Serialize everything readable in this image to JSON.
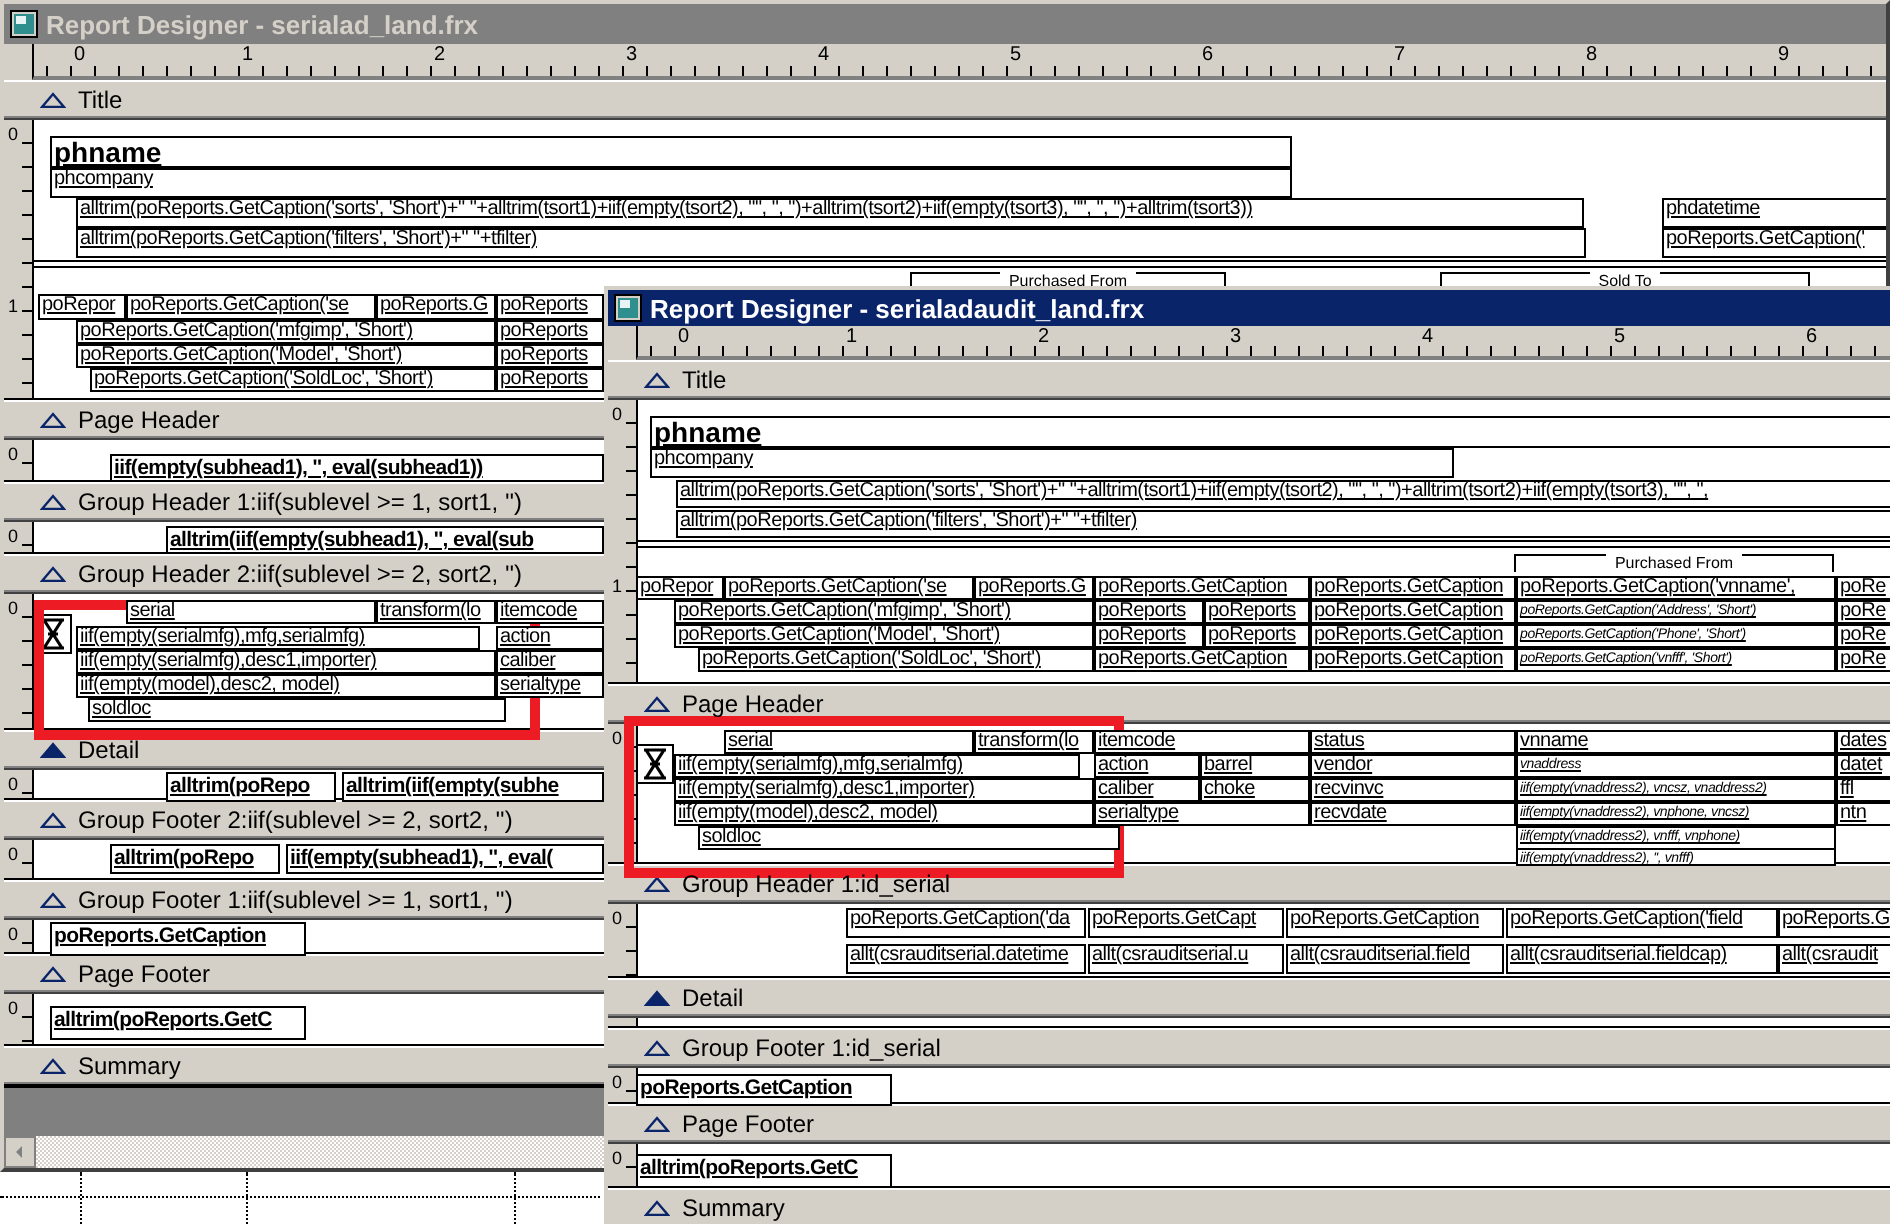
{
  "windows": [
    {
      "title": "Report Designer - serialad_land.frx",
      "active": false,
      "ruler": [
        "0",
        "1",
        "2",
        "3",
        "4",
        "5",
        "6",
        "7",
        "8",
        "9"
      ],
      "bands": [
        {
          "label": "Title",
          "selected": false,
          "ruler_labels": [
            "0",
            "1"
          ],
          "captions": [
            "Purchased From",
            "Sold To"
          ],
          "fields": [
            {
              "text": "phname",
              "kind": "title"
            },
            {
              "text": "phcompany",
              "kind": "plain"
            },
            {
              "text": "alltrim(poReports.GetCaption('sorts', 'Short')+\"  \"+alltrim(tsort1)+iif(empty(tsort2), \"\", \", \")+alltrim(tsort2)+iif(empty(tsort3), \"\", \", \")+alltrim(tsort3))",
              "kind": "plain"
            },
            {
              "text": "alltrim(poReports.GetCaption('filters', 'Short')+\"  \"+tfilter)",
              "kind": "plain"
            },
            {
              "text": "phdatetime",
              "kind": "plain"
            },
            {
              "text": "poReports.GetCaption('",
              "kind": "plain"
            },
            {
              "text": "poRepor",
              "kind": "plain"
            },
            {
              "text": "poReports.GetCaption('se",
              "kind": "plain"
            },
            {
              "text": "poReports.G",
              "kind": "plain"
            },
            {
              "text": "poReports",
              "kind": "plain"
            },
            {
              "text": "poReports.GetCaption('mfgimp', 'Short')",
              "kind": "plain"
            },
            {
              "text": "poReports",
              "kind": "plain"
            },
            {
              "text": "poReports.GetCaption('Model', 'Short')",
              "kind": "plain"
            },
            {
              "text": "poReports",
              "kind": "plain"
            },
            {
              "text": "poReports.GetCaption('SoldLoc', 'Short')",
              "kind": "plain"
            },
            {
              "text": "poReports",
              "kind": "plain"
            }
          ]
        },
        {
          "label": "Page Header",
          "selected": false,
          "ruler_labels": [
            "0"
          ],
          "fields": [
            {
              "text": "iif(empty(subhead1), '', eval(subhead1))",
              "kind": "bold"
            }
          ]
        },
        {
          "label": "Group Header 1:iif(sublevel >= 1, sort1, '')",
          "selected": false,
          "ruler_labels": [
            "0"
          ],
          "fields": [
            {
              "text": "alltrim(iif(empty(subhead1), '', eval(sub",
              "kind": "bold"
            }
          ]
        },
        {
          "label": "Group Header 2:iif(sublevel >= 2, sort2, '')",
          "selected": false,
          "ruler_labels": [
            "0"
          ],
          "fields": [
            {
              "text": "serial",
              "kind": "plain"
            },
            {
              "text": "transform(lo",
              "kind": "plain"
            },
            {
              "text": "itemcode",
              "kind": "plain"
            },
            {
              "text": "iif(empty(serialmfg),mfg,serialmfg)",
              "kind": "plain"
            },
            {
              "text": "action",
              "kind": "plain"
            },
            {
              "text": "iif(empty(serialmfg),desc1,importer)",
              "kind": "plain"
            },
            {
              "text": "caliber",
              "kind": "plain"
            },
            {
              "text": "iif(empty(model),desc2, model)",
              "kind": "plain"
            },
            {
              "text": "serialtype",
              "kind": "plain"
            },
            {
              "text": "soldloc",
              "kind": "plain"
            }
          ]
        },
        {
          "label": "Detail",
          "selected": true,
          "ruler_labels": [
            "0"
          ],
          "fields": [
            {
              "text": "alltrim(poRepo",
              "kind": "bold"
            },
            {
              "text": "alltrim(iif(empty(subhe",
              "kind": "bold"
            }
          ]
        },
        {
          "label": "Group Footer 2:iif(sublevel >= 2, sort2, '')",
          "selected": false,
          "ruler_labels": [
            "0"
          ],
          "fields": [
            {
              "text": "alltrim(poRepo",
              "kind": "bold"
            },
            {
              "text": "iif(empty(subhead1), '', eval(",
              "kind": "bold"
            }
          ]
        },
        {
          "label": "Group Footer 1:iif(sublevel >= 1, sort1, '')",
          "selected": false,
          "ruler_labels": [
            "0"
          ],
          "fields": [
            {
              "text": "poReports.GetCaption",
              "kind": "bold"
            }
          ]
        },
        {
          "label": "Page Footer",
          "selected": false,
          "ruler_labels": [
            "0"
          ],
          "fields": [
            {
              "text": "alltrim(poReports.GetC",
              "kind": "bold"
            }
          ]
        },
        {
          "label": "Summary",
          "selected": false
        }
      ]
    },
    {
      "title": "Report Designer - serialadaudit_land.frx",
      "active": true,
      "ruler": [
        "0",
        "1",
        "2",
        "3",
        "4",
        "5",
        "6"
      ],
      "bands": [
        {
          "label": "Title",
          "selected": false,
          "ruler_labels": [
            "0",
            "1"
          ],
          "captions": [
            "Purchased From"
          ],
          "fields": [
            {
              "text": "phname",
              "kind": "title"
            },
            {
              "text": "phcompany",
              "kind": "plain"
            },
            {
              "text": "alltrim(poReports.GetCaption('sorts', 'Short')+\"  \"+alltrim(tsort1)+iif(empty(tsort2), \"\", \", \")+alltrim(tsort2)+iif(empty(tsort3), \"\", \",",
              "kind": "plain"
            },
            {
              "text": "alltrim(poReports.GetCaption('filters', 'Short')+\"  \"+tfilter)",
              "kind": "plain"
            },
            {
              "text": "poRepor",
              "kind": "plain"
            },
            {
              "text": "poReports.GetCaption('se",
              "kind": "plain"
            },
            {
              "text": "poReports.G",
              "kind": "plain"
            },
            {
              "text": "poReports.GetCaption",
              "kind": "plain"
            },
            {
              "text": "poReports.GetCaption",
              "kind": "plain"
            },
            {
              "text": "poReports.GetCaption('vnname',",
              "kind": "plain"
            },
            {
              "text": "poRe",
              "kind": "plain"
            },
            {
              "text": "poReports.GetCaption('mfgimp', 'Short')",
              "kind": "plain"
            },
            {
              "text": "poReports",
              "kind": "plain"
            },
            {
              "text": "poReports",
              "kind": "plain"
            },
            {
              "text": "poReports.GetCaption",
              "kind": "plain"
            },
            {
              "text": "poReports.GetCaption('Address', 'Short')",
              "kind": "small"
            },
            {
              "text": "poRe",
              "kind": "plain"
            },
            {
              "text": "poReports.GetCaption('Model', 'Short')",
              "kind": "plain"
            },
            {
              "text": "poReports",
              "kind": "plain"
            },
            {
              "text": "poReports",
              "kind": "plain"
            },
            {
              "text": "poReports.GetCaption",
              "kind": "plain"
            },
            {
              "text": "poReports.GetCaption('Phone', 'Short')",
              "kind": "small"
            },
            {
              "text": "poRe",
              "kind": "plain"
            },
            {
              "text": "poReports.GetCaption('SoldLoc', 'Short')",
              "kind": "plain"
            },
            {
              "text": "poReports.GetCaption",
              "kind": "plain"
            },
            {
              "text": "poReports.GetCaption",
              "kind": "plain"
            },
            {
              "text": "poReports.GetCaption('vnfff', 'Short')",
              "kind": "small"
            },
            {
              "text": "poRe",
              "kind": "plain"
            }
          ]
        },
        {
          "label": "Page Header",
          "selected": false,
          "ruler_labels": [
            "0"
          ],
          "fields": [
            {
              "text": "serial",
              "kind": "plain"
            },
            {
              "text": "transform(lo",
              "kind": "plain"
            },
            {
              "text": "itemcode",
              "kind": "plain"
            },
            {
              "text": "status",
              "kind": "plain"
            },
            {
              "text": "vnname",
              "kind": "plain"
            },
            {
              "text": "dates",
              "kind": "plain"
            },
            {
              "text": "iif(empty(serialmfg),mfg,serialmfg)",
              "kind": "plain"
            },
            {
              "text": "action",
              "kind": "plain"
            },
            {
              "text": "barrel",
              "kind": "plain"
            },
            {
              "text": "vendor",
              "kind": "plain"
            },
            {
              "text": "vnaddress",
              "kind": "small"
            },
            {
              "text": "datet",
              "kind": "plain"
            },
            {
              "text": "iif(empty(serialmfg),desc1,importer)",
              "kind": "plain"
            },
            {
              "text": "caliber",
              "kind": "plain"
            },
            {
              "text": "choke",
              "kind": "plain"
            },
            {
              "text": "recvinvc",
              "kind": "plain"
            },
            {
              "text": "iif(empty(vnaddress2), vncsz, vnaddress2)",
              "kind": "small"
            },
            {
              "text": "ffl",
              "kind": "plain"
            },
            {
              "text": "iif(empty(model),desc2, model)",
              "kind": "plain"
            },
            {
              "text": "serialtype",
              "kind": "plain"
            },
            {
              "text": "recvdate",
              "kind": "plain"
            },
            {
              "text": "iif(empty(vnaddress2), vnphone, vncsz)",
              "kind": "small"
            },
            {
              "text": "ntn",
              "kind": "plain"
            },
            {
              "text": "soldloc",
              "kind": "plain"
            },
            {
              "text": "iif(empty(vnaddress2), vnfff, vnphone)",
              "kind": "small"
            },
            {
              "text": "iif(empty(vnaddress2), '', vnfff)",
              "kind": "small"
            }
          ]
        },
        {
          "label": "Group Header 1:id_serial",
          "selected": false,
          "ruler_labels": [
            "0"
          ],
          "fields": [
            {
              "text": "poReports.GetCaption('da",
              "kind": "plain"
            },
            {
              "text": "poReports.GetCapt",
              "kind": "plain"
            },
            {
              "text": "poReports.GetCaption",
              "kind": "plain"
            },
            {
              "text": "poReports.GetCaption('field",
              "kind": "plain"
            },
            {
              "text": "poReports.G",
              "kind": "plain"
            },
            {
              "text": "allt(csrauditserial.datetime",
              "kind": "plain"
            },
            {
              "text": "allt(csrauditserial.u",
              "kind": "plain"
            },
            {
              "text": "allt(csrauditserial.field",
              "kind": "plain"
            },
            {
              "text": "allt(csrauditserial.fieldcap)",
              "kind": "plain"
            },
            {
              "text": "allt(csraudit",
              "kind": "plain"
            }
          ]
        },
        {
          "label": "Detail",
          "selected": true
        },
        {
          "label": "Group Footer 1:id_serial",
          "selected": false,
          "ruler_labels": [
            "0"
          ],
          "fields": [
            {
              "text": "poReports.GetCaption",
              "kind": "bold"
            }
          ]
        },
        {
          "label": "Page Footer",
          "selected": false,
          "ruler_labels": [
            "0"
          ],
          "fields": [
            {
              "text": "alltrim(poReports.GetC",
              "kind": "bold"
            }
          ]
        },
        {
          "label": "Summary",
          "selected": false
        }
      ]
    }
  ]
}
